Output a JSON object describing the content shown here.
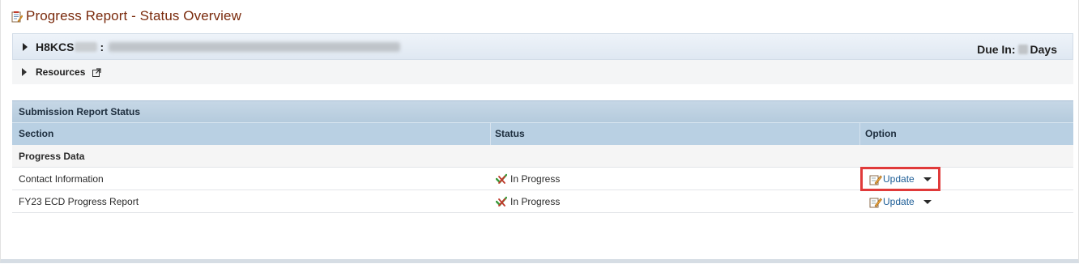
{
  "page": {
    "title": "Progress Report - Status Overview"
  },
  "grant_panel": {
    "grant_prefix": "H8KCS",
    "separator": ":",
    "due_label": "Due In:",
    "days_label": "Days"
  },
  "resources": {
    "label": "Resources"
  },
  "submission": {
    "header": "Submission Report Status",
    "columns": {
      "section": "Section",
      "status": "Status",
      "option": "Option"
    },
    "group_label": "Progress Data",
    "rows": [
      {
        "section": "Contact Information",
        "status": "In Progress",
        "option": "Update"
      },
      {
        "section": "FY23 ECD Progress Report",
        "status": "In Progress",
        "option": "Update"
      }
    ]
  },
  "colors": {
    "title": "#7a2a0c",
    "link": "#1d5d96",
    "header_bg": "#b9d0e3",
    "highlight": "#e03a3a"
  },
  "icons": {
    "title": "document-edit-icon",
    "expand": "triangle-right-icon",
    "external": "external-link-icon",
    "status": "check-cross-icon",
    "edit": "pencil-edit-icon",
    "dropdown": "caret-down-icon"
  }
}
